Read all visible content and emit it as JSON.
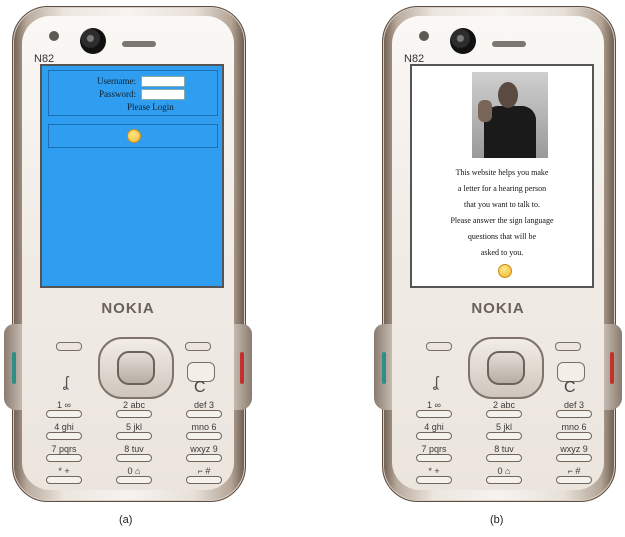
{
  "phone_a": {
    "model": "N82",
    "brand": "NOKIA",
    "caption": "(a)",
    "screen_color": "#2f9ef0",
    "login": {
      "username_label": "Username:",
      "password_label": "Password:",
      "prompt": "Please Login"
    },
    "smiley_icon": "smiley-icon"
  },
  "phone_b": {
    "model": "N82",
    "brand": "NOKIA",
    "caption": "(b)",
    "message_lines": [
      "This website helps you make",
      "a letter for a hearing person",
      "that you want to talk to.",
      "Please answer the sign language",
      "questions that will be",
      "asked to you."
    ],
    "smiley_icon": "smiley-icon"
  },
  "keypad": {
    "k1": "1 ∞",
    "k2": "2 abc",
    "k3": "def 3",
    "k4": "4 ghi",
    "k5": "5 jkl",
    "k6": "mno 6",
    "k7": "7 pqrs",
    "k8": "8 tuv",
    "k9": "wxyz 9",
    "kstar": "* +",
    "k0": "0 ⌂",
    "khash": "⌐ #",
    "clear": "C",
    "menu": "ʆ"
  },
  "colors": {
    "accent_stripe_left": "#2f8f88",
    "accent_stripe_right": "#c2312b"
  }
}
